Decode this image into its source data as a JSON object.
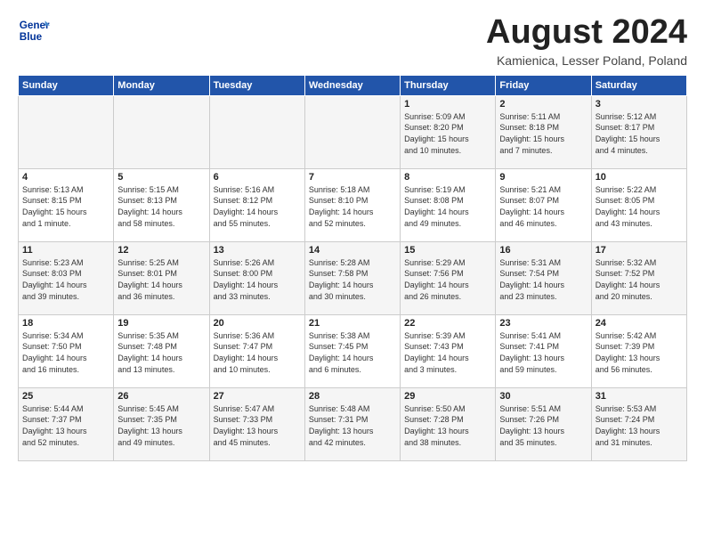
{
  "header": {
    "logo_line1": "General",
    "logo_line2": "Blue",
    "month_title": "August 2024",
    "location": "Kamienica, Lesser Poland, Poland"
  },
  "weekdays": [
    "Sunday",
    "Monday",
    "Tuesday",
    "Wednesday",
    "Thursday",
    "Friday",
    "Saturday"
  ],
  "weeks": [
    [
      {
        "day": "",
        "info": ""
      },
      {
        "day": "",
        "info": ""
      },
      {
        "day": "",
        "info": ""
      },
      {
        "day": "",
        "info": ""
      },
      {
        "day": "1",
        "info": "Sunrise: 5:09 AM\nSunset: 8:20 PM\nDaylight: 15 hours\nand 10 minutes."
      },
      {
        "day": "2",
        "info": "Sunrise: 5:11 AM\nSunset: 8:18 PM\nDaylight: 15 hours\nand 7 minutes."
      },
      {
        "day": "3",
        "info": "Sunrise: 5:12 AM\nSunset: 8:17 PM\nDaylight: 15 hours\nand 4 minutes."
      }
    ],
    [
      {
        "day": "4",
        "info": "Sunrise: 5:13 AM\nSunset: 8:15 PM\nDaylight: 15 hours\nand 1 minute."
      },
      {
        "day": "5",
        "info": "Sunrise: 5:15 AM\nSunset: 8:13 PM\nDaylight: 14 hours\nand 58 minutes."
      },
      {
        "day": "6",
        "info": "Sunrise: 5:16 AM\nSunset: 8:12 PM\nDaylight: 14 hours\nand 55 minutes."
      },
      {
        "day": "7",
        "info": "Sunrise: 5:18 AM\nSunset: 8:10 PM\nDaylight: 14 hours\nand 52 minutes."
      },
      {
        "day": "8",
        "info": "Sunrise: 5:19 AM\nSunset: 8:08 PM\nDaylight: 14 hours\nand 49 minutes."
      },
      {
        "day": "9",
        "info": "Sunrise: 5:21 AM\nSunset: 8:07 PM\nDaylight: 14 hours\nand 46 minutes."
      },
      {
        "day": "10",
        "info": "Sunrise: 5:22 AM\nSunset: 8:05 PM\nDaylight: 14 hours\nand 43 minutes."
      }
    ],
    [
      {
        "day": "11",
        "info": "Sunrise: 5:23 AM\nSunset: 8:03 PM\nDaylight: 14 hours\nand 39 minutes."
      },
      {
        "day": "12",
        "info": "Sunrise: 5:25 AM\nSunset: 8:01 PM\nDaylight: 14 hours\nand 36 minutes."
      },
      {
        "day": "13",
        "info": "Sunrise: 5:26 AM\nSunset: 8:00 PM\nDaylight: 14 hours\nand 33 minutes."
      },
      {
        "day": "14",
        "info": "Sunrise: 5:28 AM\nSunset: 7:58 PM\nDaylight: 14 hours\nand 30 minutes."
      },
      {
        "day": "15",
        "info": "Sunrise: 5:29 AM\nSunset: 7:56 PM\nDaylight: 14 hours\nand 26 minutes."
      },
      {
        "day": "16",
        "info": "Sunrise: 5:31 AM\nSunset: 7:54 PM\nDaylight: 14 hours\nand 23 minutes."
      },
      {
        "day": "17",
        "info": "Sunrise: 5:32 AM\nSunset: 7:52 PM\nDaylight: 14 hours\nand 20 minutes."
      }
    ],
    [
      {
        "day": "18",
        "info": "Sunrise: 5:34 AM\nSunset: 7:50 PM\nDaylight: 14 hours\nand 16 minutes."
      },
      {
        "day": "19",
        "info": "Sunrise: 5:35 AM\nSunset: 7:48 PM\nDaylight: 14 hours\nand 13 minutes."
      },
      {
        "day": "20",
        "info": "Sunrise: 5:36 AM\nSunset: 7:47 PM\nDaylight: 14 hours\nand 10 minutes."
      },
      {
        "day": "21",
        "info": "Sunrise: 5:38 AM\nSunset: 7:45 PM\nDaylight: 14 hours\nand 6 minutes."
      },
      {
        "day": "22",
        "info": "Sunrise: 5:39 AM\nSunset: 7:43 PM\nDaylight: 14 hours\nand 3 minutes."
      },
      {
        "day": "23",
        "info": "Sunrise: 5:41 AM\nSunset: 7:41 PM\nDaylight: 13 hours\nand 59 minutes."
      },
      {
        "day": "24",
        "info": "Sunrise: 5:42 AM\nSunset: 7:39 PM\nDaylight: 13 hours\nand 56 minutes."
      }
    ],
    [
      {
        "day": "25",
        "info": "Sunrise: 5:44 AM\nSunset: 7:37 PM\nDaylight: 13 hours\nand 52 minutes."
      },
      {
        "day": "26",
        "info": "Sunrise: 5:45 AM\nSunset: 7:35 PM\nDaylight: 13 hours\nand 49 minutes."
      },
      {
        "day": "27",
        "info": "Sunrise: 5:47 AM\nSunset: 7:33 PM\nDaylight: 13 hours\nand 45 minutes."
      },
      {
        "day": "28",
        "info": "Sunrise: 5:48 AM\nSunset: 7:31 PM\nDaylight: 13 hours\nand 42 minutes."
      },
      {
        "day": "29",
        "info": "Sunrise: 5:50 AM\nSunset: 7:28 PM\nDaylight: 13 hours\nand 38 minutes."
      },
      {
        "day": "30",
        "info": "Sunrise: 5:51 AM\nSunset: 7:26 PM\nDaylight: 13 hours\nand 35 minutes."
      },
      {
        "day": "31",
        "info": "Sunrise: 5:53 AM\nSunset: 7:24 PM\nDaylight: 13 hours\nand 31 minutes."
      }
    ]
  ]
}
